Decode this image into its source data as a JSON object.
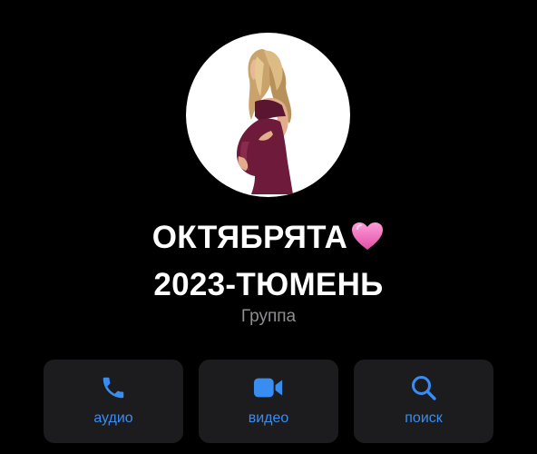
{
  "group": {
    "title_line1": "ОКТЯБРЯТА",
    "title_emoji": "💗",
    "title_line2": "2023-ТЮМЕНЬ",
    "subtitle": "Группа",
    "avatar_image": "pregnant-woman-illustration"
  },
  "actions": [
    {
      "label": "аудио",
      "icon": "phone-icon"
    },
    {
      "label": "видео",
      "icon": "video-camera-icon"
    },
    {
      "label": "поиск",
      "icon": "search-icon"
    }
  ],
  "colors": {
    "background": "#000000",
    "button_bg": "#1c1c1e",
    "accent": "#3a8df0",
    "subtitle": "#8e8e93",
    "title": "#ffffff"
  }
}
